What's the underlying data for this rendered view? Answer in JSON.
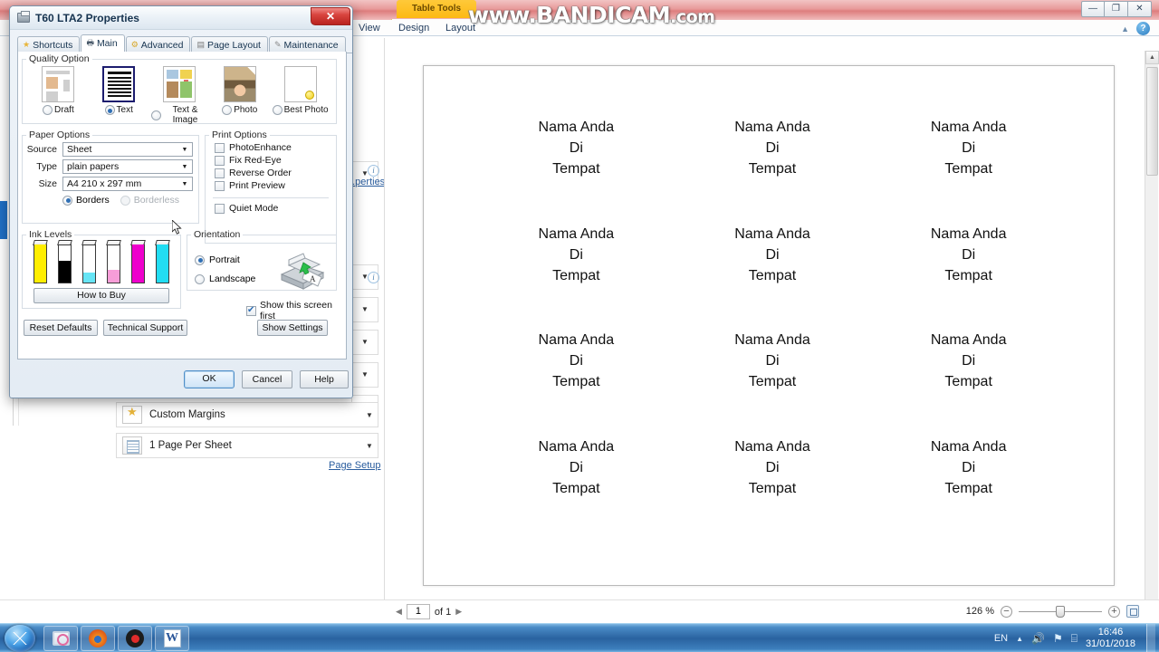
{
  "watermark": {
    "text_main": "www.BANDICAM",
    "text_suffix": ".com"
  },
  "word": {
    "table_tools_label": "Table Tools",
    "ribbon_tabs": [
      {
        "label": "View"
      },
      {
        "label": "Design"
      },
      {
        "label": "Layout"
      }
    ],
    "window_buttons": [
      {
        "name": "minimize",
        "glyph": "—"
      },
      {
        "name": "restore",
        "glyph": "❐"
      },
      {
        "name": "close",
        "glyph": "✕"
      }
    ],
    "help_icon": "?",
    "print_settings": [
      {
        "label": "Custom Margins",
        "icon": "star-icon"
      },
      {
        "label": "1 Page Per Sheet",
        "icon": "page-icon"
      }
    ],
    "printer_properties_link": "...perties",
    "page_setup_link": "Page Setup"
  },
  "preview": {
    "labels": [
      {
        "line1": "Nama Anda",
        "line2": "Di",
        "line3": "Tempat"
      },
      {
        "line1": "Nama Anda",
        "line2": "Di",
        "line3": "Tempat"
      },
      {
        "line1": "Nama Anda",
        "line2": "Di",
        "line3": "Tempat"
      },
      {
        "line1": "Nama Anda",
        "line2": "Di",
        "line3": "Tempat"
      },
      {
        "line1": "Nama Anda",
        "line2": "Di",
        "line3": "Tempat"
      },
      {
        "line1": "Nama Anda",
        "line2": "Di",
        "line3": "Tempat"
      },
      {
        "line1": "Nama Anda",
        "line2": "Di",
        "line3": "Tempat"
      },
      {
        "line1": "Nama Anda",
        "line2": "Di",
        "line3": "Tempat"
      },
      {
        "line1": "Nama Anda",
        "line2": "Di",
        "line3": "Tempat"
      },
      {
        "line1": "Nama Anda",
        "line2": "Di",
        "line3": "Tempat"
      },
      {
        "line1": "Nama Anda",
        "line2": "Di",
        "line3": "Tempat"
      },
      {
        "line1": "Nama Anda",
        "line2": "Di",
        "line3": "Tempat"
      }
    ]
  },
  "statusbar": {
    "page_current": "1",
    "page_of": "of 1",
    "prev_glyph": "◀",
    "next_glyph": "▶",
    "zoom_percent": "126 %",
    "zoom_out": "−",
    "zoom_in": "+"
  },
  "taskbar": {
    "items": [
      {
        "name": "remote-desktop-icon"
      },
      {
        "name": "firefox-icon"
      },
      {
        "name": "bandicam-icon"
      },
      {
        "name": "word-icon",
        "letter": "W"
      }
    ],
    "tray": {
      "language": "EN",
      "chevron": "▲",
      "volume": "🔊",
      "network": "⚑",
      "action_center": "⌸",
      "time": "16:46",
      "date": "31/01/2018"
    }
  },
  "dialog": {
    "title": "T60 LTA2 Properties",
    "close_glyph": "✕",
    "tabs": [
      {
        "label": "Shortcuts",
        "icon": "star-icon",
        "glyph": "★",
        "active": false
      },
      {
        "label": "Main",
        "icon": "printer-icon",
        "glyph": "🖶",
        "active": true
      },
      {
        "label": "Advanced",
        "icon": "gears-icon",
        "glyph": "⚙",
        "active": false
      },
      {
        "label": "Page Layout",
        "icon": "page-icon",
        "glyph": "▤",
        "active": false
      },
      {
        "label": "Maintenance",
        "icon": "wrench-icon",
        "glyph": "✎",
        "active": false
      }
    ],
    "quality": {
      "legend": "Quality Option",
      "options": [
        {
          "label": "Draft",
          "selected": false
        },
        {
          "label": "Text",
          "selected": true
        },
        {
          "label": "Text & Image",
          "selected": false
        },
        {
          "label": "Photo",
          "selected": false
        },
        {
          "label": "Best Photo",
          "selected": false
        }
      ]
    },
    "paper": {
      "legend": "Paper Options",
      "source_label": "Source",
      "source_value": "Sheet",
      "type_label": "Type",
      "type_value": "plain papers",
      "size_label": "Size",
      "size_value": "A4 210 x 297 mm",
      "borders_label": "Borders",
      "borders_selected": true,
      "borderless_label": "Borderless",
      "borderless_disabled": true
    },
    "print_options": {
      "legend": "Print Options",
      "items": [
        {
          "label": "PhotoEnhance",
          "checked": false
        },
        {
          "label": "Fix Red-Eye",
          "checked": false
        },
        {
          "label": "Reverse Order",
          "checked": false
        },
        {
          "label": "Print Preview",
          "checked": false
        }
      ],
      "quiet_mode": {
        "label": "Quiet Mode",
        "checked": false
      }
    },
    "ink": {
      "legend": "Ink Levels",
      "how_to_buy_label": "How to Buy",
      "cartridges": [
        {
          "name": "yellow",
          "color": "#FFEE00",
          "level": 100
        },
        {
          "name": "black",
          "color": "#000000",
          "level": 58
        },
        {
          "name": "light-cyan",
          "color": "#66E5F5",
          "level": 26
        },
        {
          "name": "light-magenta",
          "color": "#F79DD8",
          "level": 34
        },
        {
          "name": "magenta",
          "color": "#EE00CC",
          "level": 100
        },
        {
          "name": "cyan",
          "color": "#22DDF2",
          "level": 100
        }
      ]
    },
    "orientation": {
      "legend": "Orientation",
      "portrait_label": "Portrait",
      "portrait_selected": true,
      "landscape_label": "Landscape",
      "landscape_selected": false
    },
    "show_this_screen_first": {
      "label": "Show this screen first",
      "checked": true
    },
    "buttons": {
      "reset_defaults": "Reset Defaults",
      "technical_support": "Technical Support",
      "show_settings": "Show Settings",
      "ok": "OK",
      "cancel": "Cancel",
      "help": "Help"
    }
  }
}
